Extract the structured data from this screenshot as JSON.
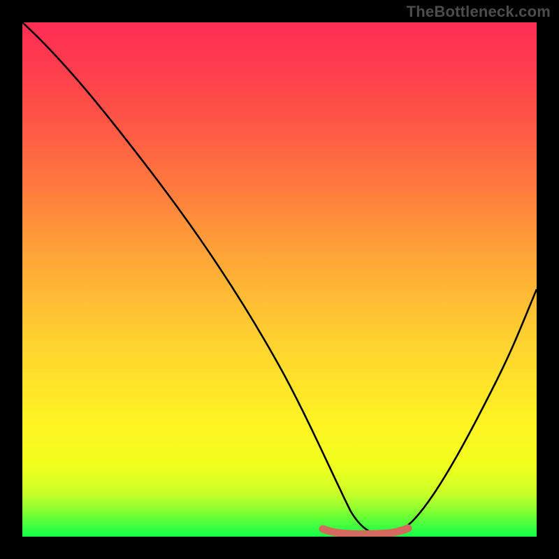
{
  "watermark": "TheBottleneck.com",
  "chart_data": {
    "type": "line",
    "title": "",
    "xlabel": "",
    "ylabel": "",
    "xlim": [
      0,
      100
    ],
    "ylim": [
      0,
      100
    ],
    "gradient_stops": [
      {
        "pct": 0,
        "color": "#ff2d55"
      },
      {
        "pct": 8,
        "color": "#ff3b4e"
      },
      {
        "pct": 18,
        "color": "#ff5247"
      },
      {
        "pct": 32,
        "color": "#ff7a3e"
      },
      {
        "pct": 45,
        "color": "#ffa438"
      },
      {
        "pct": 62,
        "color": "#ffd230"
      },
      {
        "pct": 78,
        "color": "#fff423"
      },
      {
        "pct": 86,
        "color": "#f2ff1e"
      },
      {
        "pct": 91,
        "color": "#d0ff27"
      },
      {
        "pct": 94,
        "color": "#9cff2e"
      },
      {
        "pct": 97,
        "color": "#55ff3a"
      },
      {
        "pct": 100,
        "color": "#12ff48"
      }
    ],
    "series": [
      {
        "name": "bottleneck-curve",
        "color": "#000000",
        "x": [
          0,
          5,
          10,
          15,
          20,
          25,
          30,
          35,
          40,
          45,
          50,
          55,
          58,
          60,
          65,
          70,
          73,
          75,
          80,
          85,
          90,
          95,
          100
        ],
        "y": [
          100,
          94,
          86,
          78,
          70,
          62,
          54,
          46,
          38,
          30,
          22,
          14,
          8,
          5,
          1,
          0,
          0,
          1,
          6,
          14,
          24,
          35,
          48
        ]
      },
      {
        "name": "optimal-zone-marker",
        "color": "#d46a5e",
        "x": [
          58,
          60,
          63,
          66,
          70,
          73
        ],
        "y": [
          1.2,
          0.6,
          0.3,
          0.3,
          0.5,
          1.0
        ]
      }
    ]
  }
}
